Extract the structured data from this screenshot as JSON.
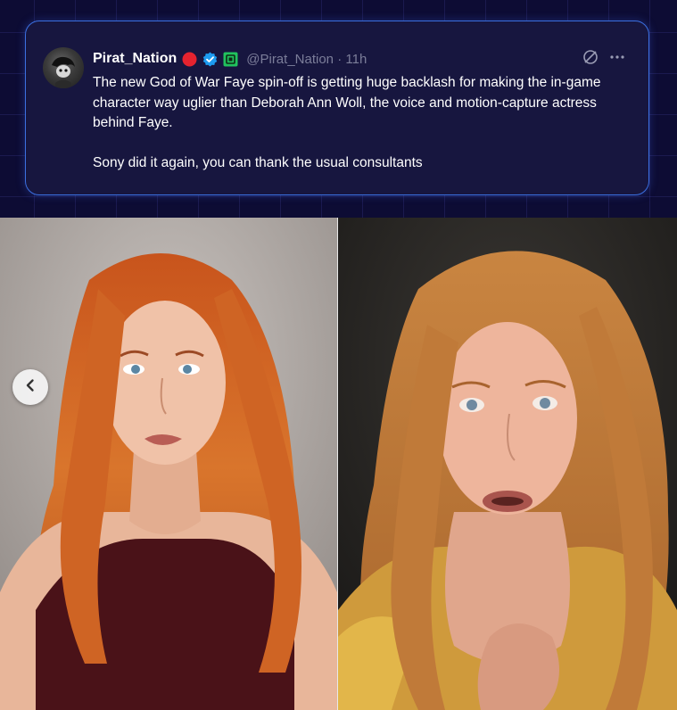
{
  "post": {
    "display_name": "Pirat_Nation",
    "handle": "@Pirat_Nation",
    "separator": "·",
    "time": "11h",
    "paragraphs": [
      "The new God of War Faye spin-off is getting huge backlash for making the in-game character way uglier than Deborah Ann Woll, the voice and motion-capture actress behind Faye.",
      "Sony did it again, you can thank the usual consultants"
    ],
    "badges": [
      "red-circle-icon",
      "verified-badge-icon",
      "green-square-icon"
    ],
    "actions": [
      "grok-icon",
      "more-options-icon"
    ]
  },
  "gallery": {
    "images": [
      "actress-photo",
      "game-character-render"
    ],
    "controls": [
      "prev-arrow-icon"
    ]
  },
  "colors": {
    "background": "#0d0c34",
    "card_background": "#17163f",
    "card_border": "#3b6fe0",
    "text": "#ffffff",
    "muted": "#7b7d99",
    "verified_blue": "#1d9bf0",
    "badge_red": "#e5232f",
    "badge_green": "#21c25e"
  }
}
